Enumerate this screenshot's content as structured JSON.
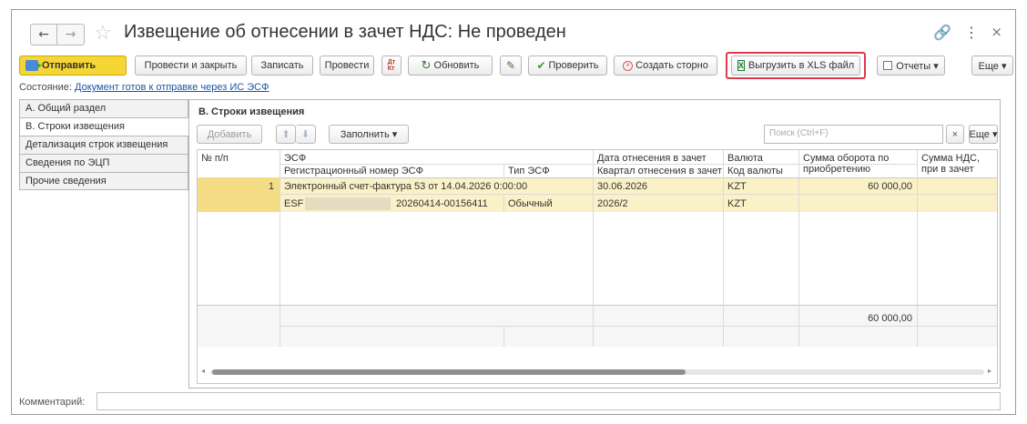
{
  "window": {
    "title": "Извещение об отнесении в зачет НДС: Не проведен",
    "back_icon": "←",
    "forward_icon": "→",
    "star_icon": "☆",
    "link_icon": "🔗",
    "more_icon": "⋮",
    "close_icon": "×"
  },
  "toolbar": {
    "send": "Отправить",
    "post_close": "Провести и закрыть",
    "save": "Записать",
    "post": "Провести",
    "dtkt": "Дт\nКт",
    "refresh": "Обновить",
    "check": "Проверить",
    "storno": "Создать сторно",
    "export_xls": "Выгрузить в XLS файл",
    "reports": "Отчеты ▾",
    "more": "Еще ▾",
    "xls_glyph": "X"
  },
  "status": {
    "label": "Состояние:",
    "link": "Документ готов к отправке через ИС ЭСФ"
  },
  "tabs": [
    {
      "label": "А. Общий раздел"
    },
    {
      "label": "В. Строки извещения"
    },
    {
      "label": "Детализация строк извещения"
    },
    {
      "label": "Сведения по ЭЦП"
    },
    {
      "label": "Прочие сведения"
    }
  ],
  "section": {
    "title": "В. Строки извещения",
    "add": "Добавить",
    "up": "⬆",
    "down": "⬇",
    "fill": "Заполнить ▾",
    "search_placeholder": "Поиск (Ctrl+F)",
    "clear": "×",
    "more": "Еще ▾"
  },
  "grid": {
    "headers": {
      "num": "№ п/п",
      "esf": "ЭСФ",
      "reg_num": "Регистрационный номер ЭСФ",
      "type": "Тип ЭСФ",
      "date": "Дата отнесения в зачет",
      "quarter": "Квартал отнесения в зачет",
      "currency": "Валюта",
      "currency_code": "Код валюты",
      "turnover": "Сумма оборота по приобретению",
      "vat": "Сумма НДС, при в зачет"
    },
    "row": {
      "num": "1",
      "esf": "Электронный счет-фактура 53 от 14.04.2026 0:00:00",
      "reg_prefix": "ESF",
      "reg_suffix": "20260414-00156411",
      "type": "Обычный",
      "date": "30.06.2026",
      "quarter": "2026/2",
      "currency": "KZT",
      "currency_code": "KZT",
      "turnover": "60 000,00"
    },
    "footer_total": "60 000,00"
  },
  "comment": {
    "label": "Комментарий:",
    "value": ""
  }
}
